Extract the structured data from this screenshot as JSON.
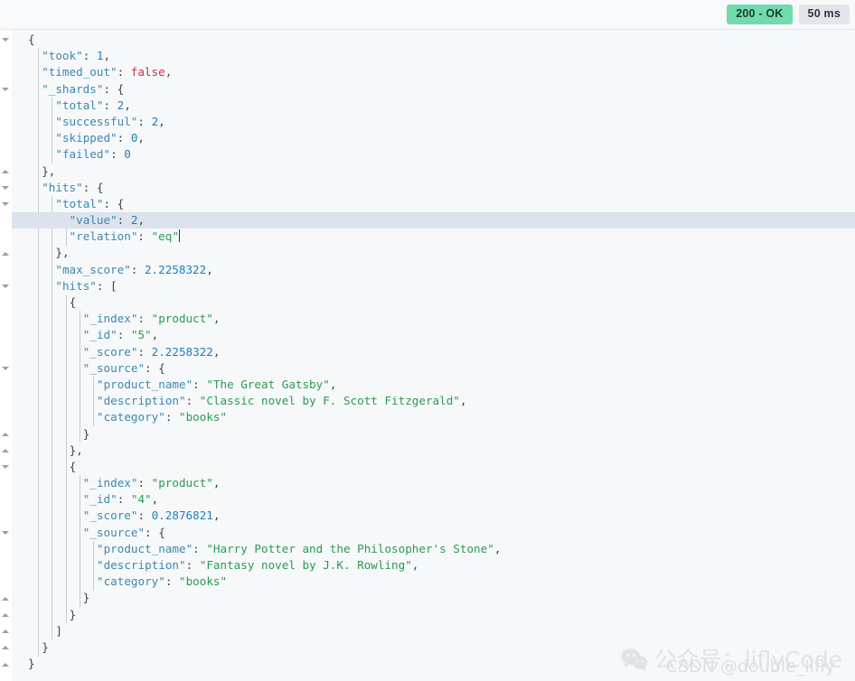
{
  "status_bar": {
    "status_badge": "200 - OK",
    "time_badge": "50 ms",
    "status_color": "#72dbad",
    "time_color": "#e2e5ea"
  },
  "viewer": {
    "language": "json",
    "highlighted_line": 11,
    "caret_line": 11,
    "colors": {
      "background": "#f6f8fa",
      "gutter": "#ffffff",
      "highlight": "#dde3ec",
      "indent_guide": "#c3cedb",
      "key": "#3e87b0",
      "string": "#2c9b51",
      "number": "#1f7fb8",
      "boolean": "#c7304b",
      "punctuation": "#394450"
    },
    "lines": [
      {
        "indent": 0,
        "fold": "open",
        "tokens": [
          {
            "t": "p",
            "v": "{"
          }
        ]
      },
      {
        "indent": 1,
        "fold": null,
        "tokens": [
          {
            "t": "k",
            "v": "\"took\""
          },
          {
            "t": "p",
            "v": ": "
          },
          {
            "t": "n",
            "v": "1"
          },
          {
            "t": "p",
            "v": ","
          }
        ]
      },
      {
        "indent": 1,
        "fold": null,
        "tokens": [
          {
            "t": "k",
            "v": "\"timed_out\""
          },
          {
            "t": "p",
            "v": ": "
          },
          {
            "t": "b",
            "v": "false"
          },
          {
            "t": "p",
            "v": ","
          }
        ]
      },
      {
        "indent": 1,
        "fold": "open",
        "tokens": [
          {
            "t": "k",
            "v": "\"_shards\""
          },
          {
            "t": "p",
            "v": ": {"
          }
        ]
      },
      {
        "indent": 2,
        "fold": null,
        "tokens": [
          {
            "t": "k",
            "v": "\"total\""
          },
          {
            "t": "p",
            "v": ": "
          },
          {
            "t": "n",
            "v": "2"
          },
          {
            "t": "p",
            "v": ","
          }
        ]
      },
      {
        "indent": 2,
        "fold": null,
        "tokens": [
          {
            "t": "k",
            "v": "\"successful\""
          },
          {
            "t": "p",
            "v": ": "
          },
          {
            "t": "n",
            "v": "2"
          },
          {
            "t": "p",
            "v": ","
          }
        ]
      },
      {
        "indent": 2,
        "fold": null,
        "tokens": [
          {
            "t": "k",
            "v": "\"skipped\""
          },
          {
            "t": "p",
            "v": ": "
          },
          {
            "t": "n",
            "v": "0"
          },
          {
            "t": "p",
            "v": ","
          }
        ]
      },
      {
        "indent": 2,
        "fold": null,
        "tokens": [
          {
            "t": "k",
            "v": "\"failed\""
          },
          {
            "t": "p",
            "v": ": "
          },
          {
            "t": "n",
            "v": "0"
          }
        ]
      },
      {
        "indent": 1,
        "fold": "close",
        "tokens": [
          {
            "t": "p",
            "v": "},"
          }
        ]
      },
      {
        "indent": 1,
        "fold": "open",
        "tokens": [
          {
            "t": "k",
            "v": "\"hits\""
          },
          {
            "t": "p",
            "v": ": {"
          }
        ]
      },
      {
        "indent": 2,
        "fold": "open",
        "tokens": [
          {
            "t": "k",
            "v": "\"total\""
          },
          {
            "t": "p",
            "v": ": {"
          }
        ]
      },
      {
        "indent": 3,
        "fold": null,
        "tokens": [
          {
            "t": "k",
            "v": "\"value\""
          },
          {
            "t": "p",
            "v": ": "
          },
          {
            "t": "n",
            "v": "2"
          },
          {
            "t": "p",
            "v": ","
          }
        ]
      },
      {
        "indent": 3,
        "fold": null,
        "caret": true,
        "tokens": [
          {
            "t": "k",
            "v": "\"relation\""
          },
          {
            "t": "p",
            "v": ": "
          },
          {
            "t": "s",
            "v": "\"eq\""
          }
        ]
      },
      {
        "indent": 2,
        "fold": "close",
        "tokens": [
          {
            "t": "p",
            "v": "},"
          }
        ]
      },
      {
        "indent": 2,
        "fold": null,
        "tokens": [
          {
            "t": "k",
            "v": "\"max_score\""
          },
          {
            "t": "p",
            "v": ": "
          },
          {
            "t": "n",
            "v": "2.2258322"
          },
          {
            "t": "p",
            "v": ","
          }
        ]
      },
      {
        "indent": 2,
        "fold": "open",
        "tokens": [
          {
            "t": "k",
            "v": "\"hits\""
          },
          {
            "t": "p",
            "v": ": ["
          }
        ]
      },
      {
        "indent": 3,
        "fold": null,
        "tokens": [
          {
            "t": "p",
            "v": "{"
          }
        ]
      },
      {
        "indent": 4,
        "fold": null,
        "tokens": [
          {
            "t": "k",
            "v": "\"_index\""
          },
          {
            "t": "p",
            "v": ": "
          },
          {
            "t": "s",
            "v": "\"product\""
          },
          {
            "t": "p",
            "v": ","
          }
        ]
      },
      {
        "indent": 4,
        "fold": null,
        "tokens": [
          {
            "t": "k",
            "v": "\"_id\""
          },
          {
            "t": "p",
            "v": ": "
          },
          {
            "t": "s",
            "v": "\"5\""
          },
          {
            "t": "p",
            "v": ","
          }
        ]
      },
      {
        "indent": 4,
        "fold": null,
        "tokens": [
          {
            "t": "k",
            "v": "\"_score\""
          },
          {
            "t": "p",
            "v": ": "
          },
          {
            "t": "n",
            "v": "2.2258322"
          },
          {
            "t": "p",
            "v": ","
          }
        ]
      },
      {
        "indent": 4,
        "fold": "open",
        "tokens": [
          {
            "t": "k",
            "v": "\"_source\""
          },
          {
            "t": "p",
            "v": ": {"
          }
        ]
      },
      {
        "indent": 5,
        "fold": null,
        "tokens": [
          {
            "t": "k",
            "v": "\"product_name\""
          },
          {
            "t": "p",
            "v": ": "
          },
          {
            "t": "s",
            "v": "\"The Great Gatsby\""
          },
          {
            "t": "p",
            "v": ","
          }
        ]
      },
      {
        "indent": 5,
        "fold": null,
        "tokens": [
          {
            "t": "k",
            "v": "\"description\""
          },
          {
            "t": "p",
            "v": ": "
          },
          {
            "t": "s",
            "v": "\"Classic novel by F. Scott Fitzgerald\""
          },
          {
            "t": "p",
            "v": ","
          }
        ]
      },
      {
        "indent": 5,
        "fold": null,
        "tokens": [
          {
            "t": "k",
            "v": "\"category\""
          },
          {
            "t": "p",
            "v": ": "
          },
          {
            "t": "s",
            "v": "\"books\""
          }
        ]
      },
      {
        "indent": 4,
        "fold": "close",
        "tokens": [
          {
            "t": "p",
            "v": "}"
          }
        ]
      },
      {
        "indent": 3,
        "fold": "close",
        "tokens": [
          {
            "t": "p",
            "v": "},"
          }
        ]
      },
      {
        "indent": 3,
        "fold": "open",
        "tokens": [
          {
            "t": "p",
            "v": "{"
          }
        ]
      },
      {
        "indent": 4,
        "fold": null,
        "tokens": [
          {
            "t": "k",
            "v": "\"_index\""
          },
          {
            "t": "p",
            "v": ": "
          },
          {
            "t": "s",
            "v": "\"product\""
          },
          {
            "t": "p",
            "v": ","
          }
        ]
      },
      {
        "indent": 4,
        "fold": null,
        "tokens": [
          {
            "t": "k",
            "v": "\"_id\""
          },
          {
            "t": "p",
            "v": ": "
          },
          {
            "t": "s",
            "v": "\"4\""
          },
          {
            "t": "p",
            "v": ","
          }
        ]
      },
      {
        "indent": 4,
        "fold": null,
        "tokens": [
          {
            "t": "k",
            "v": "\"_score\""
          },
          {
            "t": "p",
            "v": ": "
          },
          {
            "t": "n",
            "v": "0.2876821"
          },
          {
            "t": "p",
            "v": ","
          }
        ]
      },
      {
        "indent": 4,
        "fold": "open",
        "tokens": [
          {
            "t": "k",
            "v": "\"_source\""
          },
          {
            "t": "p",
            "v": ": {"
          }
        ]
      },
      {
        "indent": 5,
        "fold": null,
        "tokens": [
          {
            "t": "k",
            "v": "\"product_name\""
          },
          {
            "t": "p",
            "v": ": "
          },
          {
            "t": "s",
            "v": "\"Harry Potter and the Philosopher's Stone\""
          },
          {
            "t": "p",
            "v": ","
          }
        ]
      },
      {
        "indent": 5,
        "fold": null,
        "tokens": [
          {
            "t": "k",
            "v": "\"description\""
          },
          {
            "t": "p",
            "v": ": "
          },
          {
            "t": "s",
            "v": "\"Fantasy novel by J.K. Rowling\""
          },
          {
            "t": "p",
            "v": ","
          }
        ]
      },
      {
        "indent": 5,
        "fold": null,
        "tokens": [
          {
            "t": "k",
            "v": "\"category\""
          },
          {
            "t": "p",
            "v": ": "
          },
          {
            "t": "s",
            "v": "\"books\""
          }
        ]
      },
      {
        "indent": 4,
        "fold": "close",
        "tokens": [
          {
            "t": "p",
            "v": "}"
          }
        ]
      },
      {
        "indent": 3,
        "fold": "close",
        "tokens": [
          {
            "t": "p",
            "v": "}"
          }
        ]
      },
      {
        "indent": 2,
        "fold": "close",
        "tokens": [
          {
            "t": "p",
            "v": "]"
          }
        ]
      },
      {
        "indent": 1,
        "fold": "close",
        "tokens": [
          {
            "t": "p",
            "v": "}"
          }
        ]
      },
      {
        "indent": 0,
        "fold": "close",
        "tokens": [
          {
            "t": "p",
            "v": "}"
          }
        ]
      }
    ]
  },
  "response_json": {
    "took": 1,
    "timed_out": false,
    "_shards": {
      "total": 2,
      "successful": 2,
      "skipped": 0,
      "failed": 0
    },
    "hits": {
      "total": {
        "value": 2,
        "relation": "eq"
      },
      "max_score": 2.2258322,
      "hits": [
        {
          "_index": "product",
          "_id": "5",
          "_score": 2.2258322,
          "_source": {
            "product_name": "The Great Gatsby",
            "description": "Classic novel by F. Scott Fitzgerald",
            "category": "books"
          }
        },
        {
          "_index": "product",
          "_id": "4",
          "_score": 0.2876821,
          "_source": {
            "product_name": "Harry Potter and the Philosopher's Stone",
            "description": "Fantasy novel by J.K. Rowling",
            "category": "books"
          }
        }
      ]
    }
  },
  "watermark": {
    "icon": "wechat-icon",
    "line1": "公众号：liflyCode",
    "line2": "CSDN @double_lifly"
  }
}
